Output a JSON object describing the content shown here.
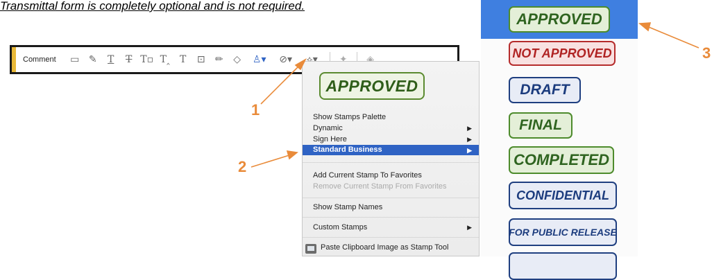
{
  "note": "Transmittal form is completely optional and is not required.",
  "toolbar": {
    "label": "Comment",
    "icons": [
      "sticky-note-icon",
      "highlight-icon",
      "underline-text-icon",
      "strikethrough-text-icon",
      "replace-text-icon",
      "insert-text-icon",
      "add-text-icon",
      "text-box-icon",
      "pencil-icon",
      "eraser-icon",
      "stamp-icon",
      "attach-file-icon",
      "draw-shapes-icon",
      "pin-icon",
      "fill-icon"
    ]
  },
  "menu": {
    "stamp_preview": "APPROVED",
    "items": [
      {
        "label": "Show Stamps Palette",
        "submenu": false
      },
      {
        "label": "Dynamic",
        "submenu": true
      },
      {
        "label": "Sign Here",
        "submenu": true
      },
      {
        "label": "Standard Business",
        "submenu": true,
        "highlighted": true
      },
      {
        "label": "Add Current Stamp To Favorites",
        "submenu": false
      },
      {
        "label": "Remove Current Stamp From Favorites",
        "submenu": false,
        "disabled": true
      },
      {
        "label": "Show Stamp Names",
        "submenu": false
      },
      {
        "label": "Custom Stamps",
        "submenu": true
      },
      {
        "label": "Paste Clipboard Image as Stamp Tool",
        "submenu": false
      }
    ],
    "arrow": "▶"
  },
  "palette": {
    "stamps": [
      "APPROVED",
      "NOT APPROVED",
      "DRAFT",
      "FINAL",
      "COMPLETED",
      "CONFIDENTIAL",
      "FOR PUBLIC RELEASE"
    ],
    "highlight_color": "#3f7fe0"
  },
  "annotations": {
    "n1": "1",
    "n2": "2",
    "n3": "3",
    "color": "#e98b3a"
  }
}
